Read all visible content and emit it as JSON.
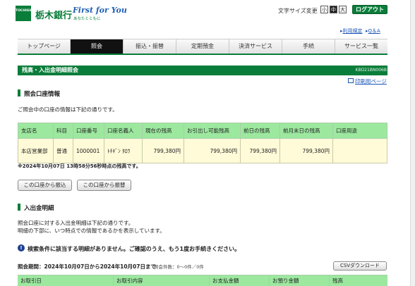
{
  "header": {
    "logo_text": "TOCHIGIN",
    "bank_name": "栃木銀行",
    "slogan": "First for You",
    "slogan_sub": "あなたとともに",
    "font_size_label": "文字サイズ変更",
    "font_sizes": [
      "小",
      "中",
      "大"
    ],
    "logout_label": "ログアウト",
    "links": [
      "利用規定",
      "Q＆A"
    ]
  },
  "nav": {
    "items": [
      "トップページ",
      "照会",
      "振込・振替",
      "定期預金",
      "決済サービス",
      "手続",
      "サービス一覧"
    ],
    "active": "照会"
  },
  "page": {
    "title": "残高・入出金明細照会",
    "screen_id": "KBD21BN006B",
    "print_link": "印刷用ページ"
  },
  "account_section": {
    "heading": "照会口座情報",
    "description": "ご照会中の口座の情報は下記の通りです。",
    "columns": [
      "支店名",
      "科目",
      "口座番号",
      "口座名義人",
      "現在の残高",
      "お引出し可能残高",
      "前日の残高",
      "前月末日の残高",
      "口座用途"
    ],
    "row": [
      "本店営業部",
      "普通",
      "1000001",
      "ﾄﾁｷﾞﾝ ﾀﾛｳ",
      "799,380円",
      "799,380円",
      "799,380円",
      "799,380円",
      ""
    ],
    "as_of": "※2024年10月07日 13時58分56秒時点の残高です。",
    "buttons": [
      "この口座から振込",
      "この口座から振替"
    ]
  },
  "detail_section": {
    "heading": "入出金明細",
    "description_1": "照会口座に対する入出金明細は下記の通りです。",
    "description_2": "明細の下部に、いつ時点での情報であるかを表示しています。",
    "info_message": "検索条件に該当する明細がありません。ご確認のうえ、もう1度お手続きください。",
    "period": "照会期間：2024年10月07日から2024年10月07日まで",
    "count": "照会件数：0～0件／0件",
    "csv_button": "CSVダウンロード",
    "columns": [
      "お取引日",
      "お取引内容",
      "お支払金額",
      "お預り金額",
      "残高"
    ]
  },
  "colors": {
    "brand_green": "#0a7d3a",
    "table_header": "#9ce89f",
    "table_row": "#fffbd8",
    "link_blue": "#1a55b5"
  }
}
